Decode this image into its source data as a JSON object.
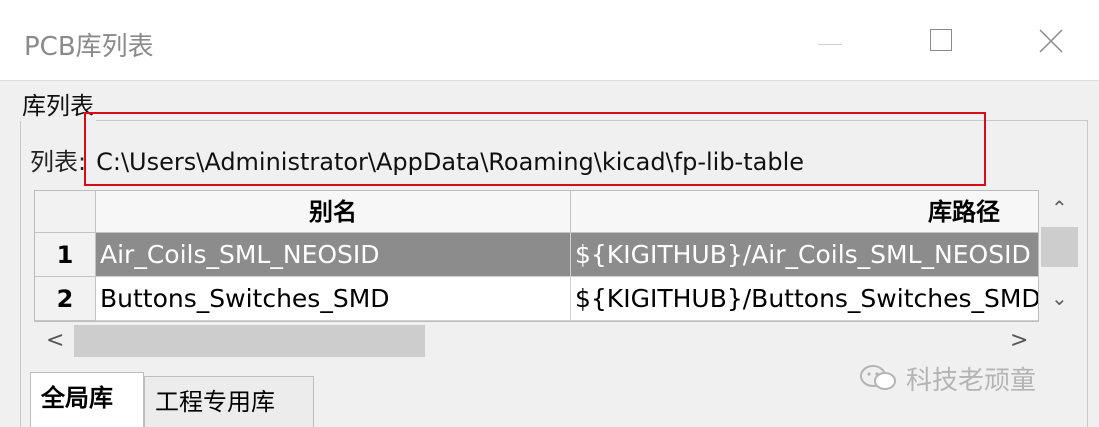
{
  "window": {
    "title": "PCB库列表",
    "controls": {
      "minimize_icon": "minimize-icon",
      "maximize_icon": "maximize-icon",
      "close_icon": "close-icon"
    }
  },
  "group": {
    "title": "库列表",
    "path_label": "列表:",
    "path_value": "C:\\Users\\Administrator\\AppData\\Roaming\\kicad\\fp-lib-table"
  },
  "table": {
    "columns": [
      "别名",
      "库路径"
    ],
    "rows": [
      {
        "num": "1",
        "alias": "Air_Coils_SML_NEOSID",
        "path": "${KIGITHUB}/Air_Coils_SML_NEOSID",
        "selected": true
      },
      {
        "num": "2",
        "alias": "Buttons_Switches_SMD",
        "path": "${KIGITHUB}/Buttons_Switches_SMD",
        "selected": false
      }
    ],
    "selection_color": "#8c8c8c"
  },
  "tabs": [
    {
      "label": "全局库",
      "active": true
    },
    {
      "label": "工程专用库",
      "active": false
    }
  ],
  "watermark": {
    "text": "科技老顽童",
    "icon": "wechat-icon"
  },
  "colors": {
    "highlight_box": "#d80c18",
    "dialog_bg": "#f0f0f0"
  }
}
